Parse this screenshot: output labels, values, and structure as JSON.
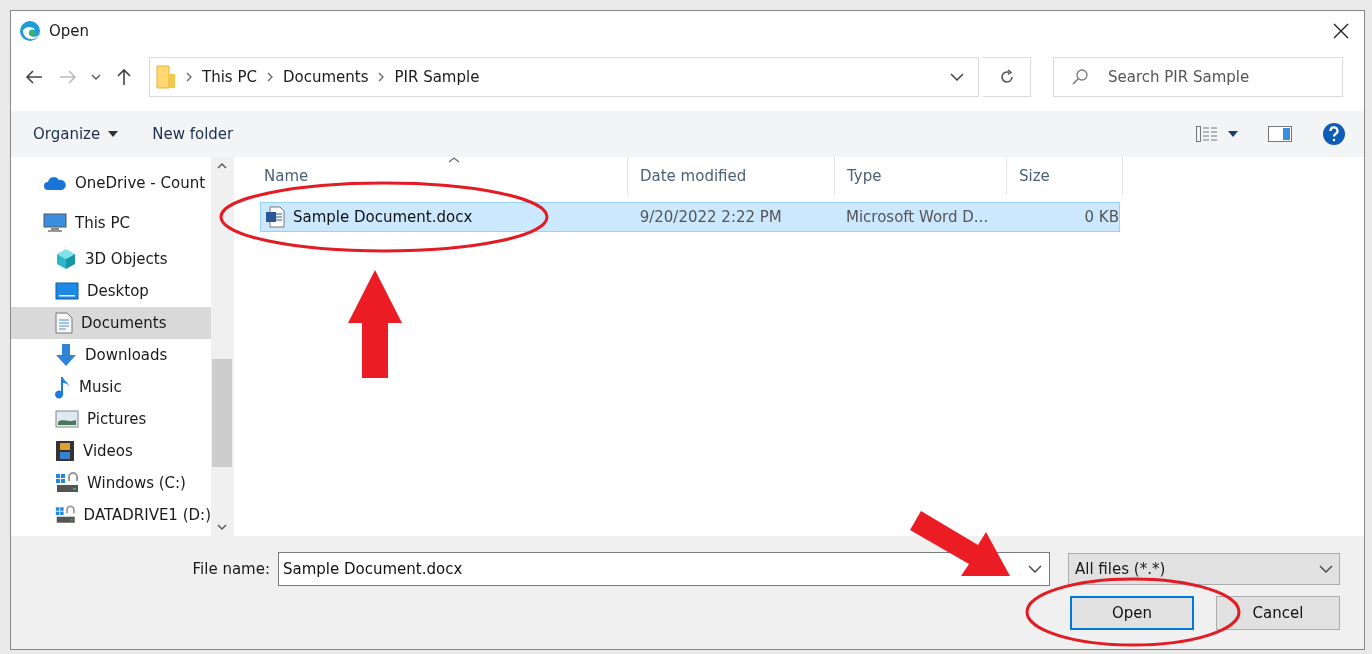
{
  "window": {
    "title": "Open"
  },
  "address": {
    "path": [
      "This PC",
      "Documents",
      "PIR Sample"
    ]
  },
  "search": {
    "placeholder": "Search PIR Sample"
  },
  "toolbar": {
    "items": [
      "Organize",
      "New folder"
    ]
  },
  "sidebar": {
    "items": [
      {
        "label": "OneDrive - Count",
        "kind": "cloud",
        "selected": false
      },
      {
        "label": "This PC",
        "kind": "computer",
        "selected": false,
        "children": [
          {
            "label": "3D Objects",
            "kind": "cube",
            "selected": false
          },
          {
            "label": "Desktop",
            "kind": "desktop",
            "selected": false
          },
          {
            "label": "Documents",
            "kind": "document",
            "selected": true
          },
          {
            "label": "Downloads",
            "kind": "download",
            "selected": false
          },
          {
            "label": "Music",
            "kind": "music",
            "selected": false
          },
          {
            "label": "Pictures",
            "kind": "pictures",
            "selected": false
          },
          {
            "label": "Videos",
            "kind": "videos",
            "selected": false
          },
          {
            "label": "Windows (C:)",
            "kind": "drive",
            "selected": false
          },
          {
            "label": "DATADRIVE1 (D:)",
            "kind": "drive",
            "selected": false
          }
        ]
      }
    ]
  },
  "table": {
    "columns": [
      "Name",
      "Date modified",
      "Type",
      "Size"
    ],
    "rows": [
      {
        "name": "Sample Document.docx",
        "date_modified": "9/20/2022 2:22 PM",
        "type": "Microsoft Word D...",
        "size": "0 KB",
        "selected": true
      }
    ]
  },
  "file_name": {
    "label": "File name:",
    "value": "Sample Document.docx"
  },
  "file_type": {
    "value": "All files (*.*)"
  },
  "buttons": [
    {
      "label": "Open",
      "default": true
    },
    {
      "label": "Cancel",
      "default": false
    }
  ]
}
